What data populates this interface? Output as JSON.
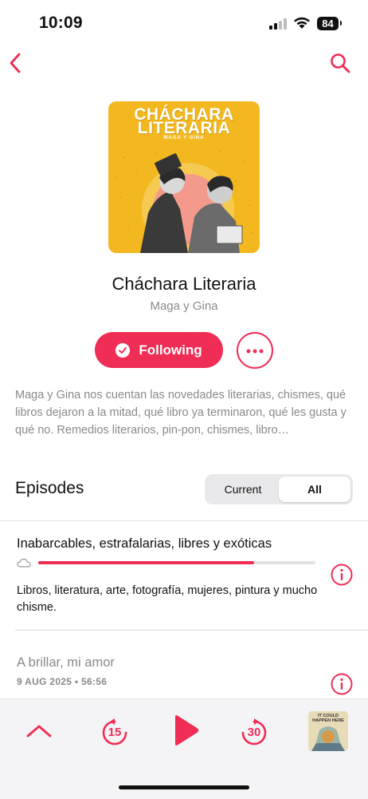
{
  "status_bar": {
    "time": "10:09",
    "battery": "84"
  },
  "nav": {
    "back_icon": "chevron-left-icon",
    "search_icon": "search-icon"
  },
  "artwork": {
    "title_line1": "CHÁCHARA",
    "title_line2": "LITERARIA",
    "subtitle": "MAGA Y GINA"
  },
  "podcast": {
    "title": "Cháchara Literaria",
    "author": "Maga y Gina",
    "follow_label": "Following",
    "description": "Maga y Gina nos cuentan las novedades literarias, chismes, qué libros dejaron a la mitad, qué libro ya terminaron, qué les gusta y qué no. Remedios literarios, pin-pon, chismes, libro…"
  },
  "episodes": {
    "heading": "Episodes",
    "segments": {
      "current": "Current",
      "all": "All",
      "selected": "All"
    },
    "items": [
      {
        "title": "Inabarcables, estrafalarias, libres y exóticas",
        "progress": 0.78,
        "description": "Libros, literatura, arte, fotografía, mujeres, pintura y mucho chisme."
      },
      {
        "title": "A brillar, mi amor",
        "meta": "9 AUG 2025 • 56:56"
      }
    ]
  },
  "player": {
    "skip_back": "15",
    "skip_forward": "30",
    "mini_art_text": "IT COULD HAPPEN HERE"
  },
  "colors": {
    "accent": "#ef2d55",
    "secondary_text": "#8a8a8e",
    "art_bg": "#f3b81f"
  }
}
